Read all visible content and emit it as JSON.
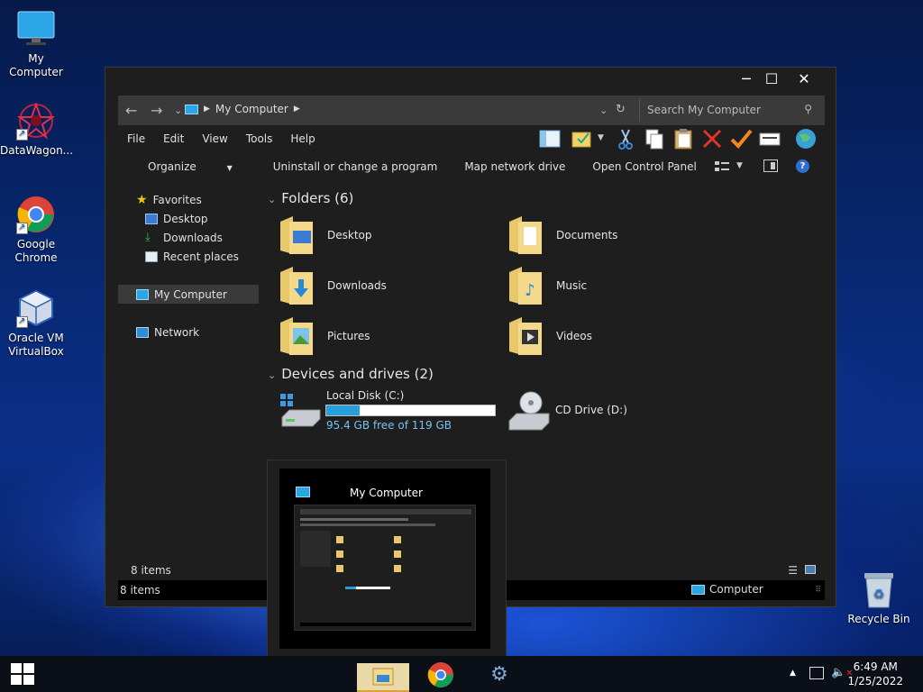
{
  "desktop": {
    "icons": [
      {
        "label": "My Computer"
      },
      {
        "label": "DataWagon..."
      },
      {
        "label": "Google Chrome"
      },
      {
        "label": "Oracle VM VirtualBox"
      },
      {
        "label": "Recycle Bin"
      }
    ]
  },
  "window": {
    "address": "My Computer",
    "search_placeholder": "Search My Computer",
    "menu": [
      "File",
      "Edit",
      "View",
      "Tools",
      "Help"
    ],
    "commands": [
      "Organize",
      "Uninstall or change a program",
      "Map network drive",
      "Open Control Panel"
    ],
    "navpane": {
      "favorites": "Favorites",
      "desktop": "Desktop",
      "downloads": "Downloads",
      "recent": "Recent places",
      "my_computer": "My Computer",
      "network": "Network"
    },
    "folders_header": "Folders (6)",
    "folders": [
      "Desktop",
      "Documents",
      "Downloads",
      "Music",
      "Pictures",
      "Videos"
    ],
    "devices_header": "Devices and drives (2)",
    "drive_c": {
      "name": "Local Disk (C:)",
      "free": "95.4 GB free of 119 GB",
      "used_fraction": 0.2
    },
    "drive_d": {
      "name": "CD Drive (D:)"
    },
    "status_items": "8 items",
    "status_items2": "8 items",
    "status_location": "Computer"
  },
  "thumbnail": {
    "title": "My Computer"
  },
  "taskbar": {
    "time": "6:49 AM",
    "date": "1/25/2022"
  },
  "colors": {
    "accent": "#1e88d6",
    "window_bg": "#1e1e1e",
    "address_bg": "#3a3a3a"
  }
}
